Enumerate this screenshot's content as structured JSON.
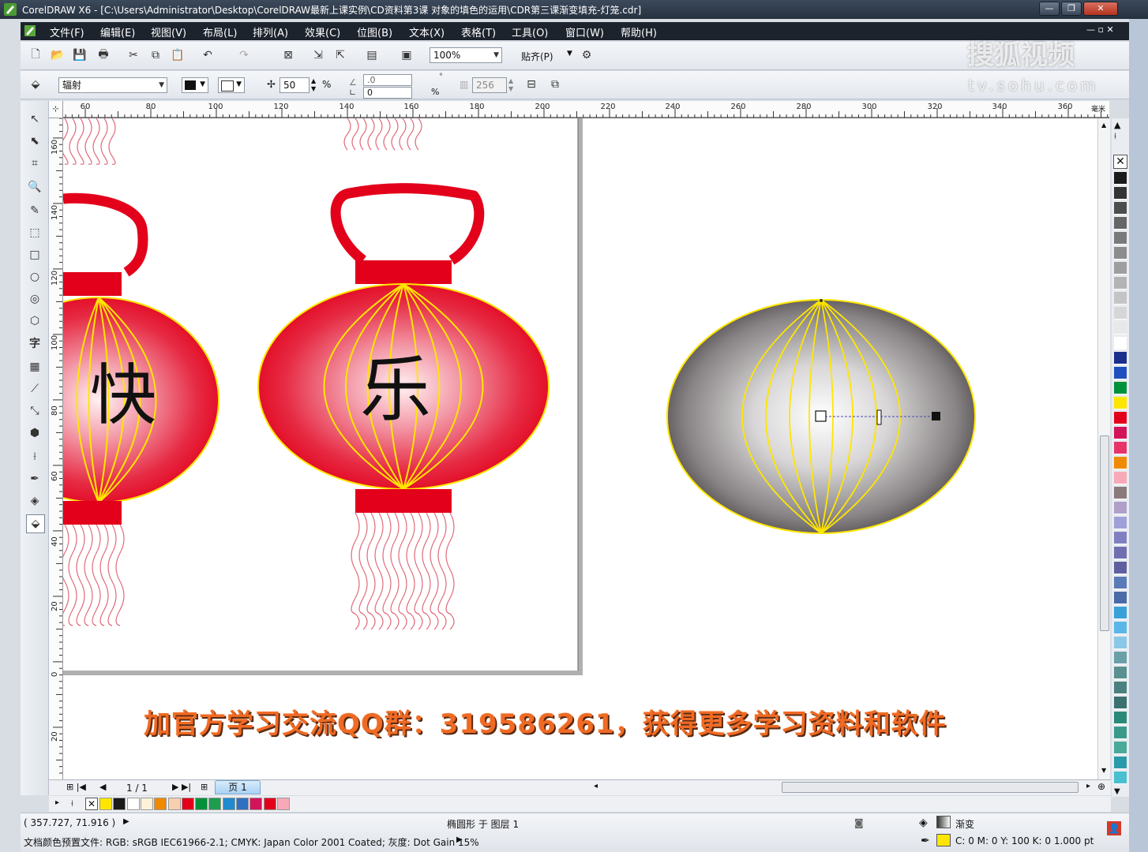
{
  "window": {
    "title": "CorelDRAW X6 - [C:\\Users\\Administrator\\Desktop\\CorelDRAW最新上课实例\\CD资料第3课  对象的填色的运用\\CDR第三课渐变填充-灯笼.cdr]",
    "controls": [
      "—",
      "❐",
      "✕"
    ]
  },
  "menu": [
    "文件(F)",
    "编辑(E)",
    "视图(V)",
    "布局(L)",
    "排列(A)",
    "效果(C)",
    "位图(B)",
    "文本(X)",
    "表格(T)",
    "工具(O)",
    "窗口(W)",
    "帮助(H)"
  ],
  "standard_toolbar": {
    "zoom": "100%",
    "snap_label": "贴齐(P)"
  },
  "property_bar": {
    "fill_type": "辐射",
    "midpoint": "50",
    "percent_sign": "%",
    "angle": ".0",
    "edge_pad": "0",
    "steps": "256",
    "degree_sign": "°"
  },
  "ruler": {
    "unit_label": "毫米",
    "h_ticks": [
      "60",
      "80",
      "100",
      "120",
      "140",
      "160",
      "180",
      "200",
      "220",
      "240",
      "260",
      "280",
      "300",
      "320",
      "340",
      "360"
    ],
    "v_ticks": [
      "160",
      "140",
      "120",
      "100",
      "80",
      "60",
      "40",
      "20",
      "0",
      "20",
      "40"
    ]
  },
  "canvas": {
    "lantern_chars": [
      "快",
      "乐"
    ]
  },
  "page_nav": {
    "counter": "1 / 1",
    "tab": "页 1"
  },
  "status": {
    "coords": "( 357.727, 71.916 )",
    "object_info": "椭圆形 于 图层 1",
    "doc_color": "文档颜色预置文件: RGB: sRGB IEC61966-2.1; CMYK: Japan Color 2001 Coated; 灰度: Dot Gain 15%",
    "fill_name": "渐变",
    "outline_info": "C: 0 M: 0 Y: 100 K: 0  1.000 pt"
  },
  "overlay": {
    "banner": "加官方学习交流QQ群：319586261，获得更多学习资料和软件",
    "watermark": "搜狐视频",
    "watermark_url": "tv.sohu.com"
  },
  "colors": {
    "lantern_red": "#e3001b",
    "outline_yellow": "#ffe600",
    "palette": [
      "#1a1a1a",
      "#333333",
      "#4d4d4d",
      "#666666",
      "#7a7a7a",
      "#8c8c8c",
      "#9e9e9e",
      "#b3b3b3",
      "#c4c4c4",
      "#d6d6d6",
      "#e8e8e8",
      "#ffffff",
      "#1a2f8c",
      "#1f4fbf",
      "#00913a",
      "#ffe600",
      "#e3001b",
      "#d4145a",
      "#e8336a",
      "#f08a00",
      "#f7a9b8",
      "#8a7a7a",
      "#b0a0c8",
      "#a0a0d8",
      "#8080c0",
      "#7070b0",
      "#6060a0",
      "#5a7ab8",
      "#4a6aa8",
      "#3aa0d8",
      "#5ab8e8",
      "#8ac8e8",
      "#6aa0a8",
      "#5a9090",
      "#4a8080",
      "#3a7070",
      "#2a8a7a",
      "#3a9a8a",
      "#4aaa9a",
      "#2a9aaa",
      "#48c0d0"
    ],
    "bottom_palette": [
      "#ffe600",
      "#1a1a1a",
      "#ffffff",
      "#fff2d8",
      "#f08a00",
      "#f7d0b0",
      "#e3001b",
      "#00913a",
      "#1f9d4f",
      "#1f8ad0",
      "#3070c0",
      "#d4145a",
      "#e3001b",
      "#f7a9b8"
    ]
  }
}
